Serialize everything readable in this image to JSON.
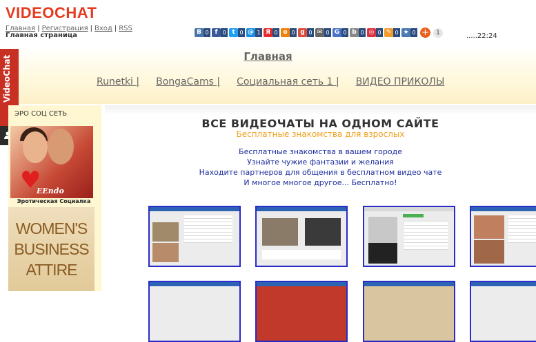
{
  "site": {
    "logo": "VIDEOCHAT",
    "links": [
      "Главная",
      "Регистрация",
      "Вход",
      "RSS"
    ],
    "link_sep": "|",
    "subtitle": "Главная страница",
    "clock": ".....22:24"
  },
  "share": {
    "buttons": [
      {
        "icon": "vkontakte-icon",
        "glyph": "В",
        "color": "#4a76a8",
        "count": "0"
      },
      {
        "icon": "facebook-icon",
        "glyph": "f",
        "color": "#3b5998",
        "count": "0"
      },
      {
        "icon": "twitter-icon",
        "glyph": "t",
        "color": "#1da1f2",
        "count": "0"
      },
      {
        "icon": "mailru-icon",
        "glyph": "@",
        "color": "#168de2",
        "count": "1"
      },
      {
        "icon": "yandex-icon",
        "glyph": "Я",
        "color": "#e52b2b",
        "count": "0"
      },
      {
        "icon": "odnoklassniki-icon",
        "glyph": "o",
        "color": "#ee8208",
        "count": "0"
      },
      {
        "icon": "googleplus-icon",
        "glyph": "g",
        "color": "#dd4b39",
        "count": "0"
      },
      {
        "icon": "email-icon",
        "glyph": "✉",
        "color": "#666666",
        "count": "0"
      },
      {
        "icon": "google-icon",
        "glyph": "G",
        "color": "#4a73c9",
        "count": "0"
      },
      {
        "icon": "blogger-icon",
        "glyph": "b",
        "color": "#888888",
        "count": "0"
      },
      {
        "icon": "liveinternet-icon",
        "glyph": "◎",
        "color": "#d9333f",
        "count": "0"
      },
      {
        "icon": "livejournal-icon",
        "glyph": "✎",
        "color": "#f39c2b",
        "count": "0"
      },
      {
        "icon": "bookmark-icon",
        "glyph": "★",
        "color": "#4c79b5",
        "count": "0"
      }
    ],
    "more_glyph": "+",
    "total": "1"
  },
  "hero": {
    "title": "Главная",
    "nav": [
      "Runetki |",
      "BongaCams |",
      "Социальная сеть 1 |",
      "ВИДЕО ПРИКОЛЫ"
    ]
  },
  "side_tab": {
    "label": "VideoChat"
  },
  "left": {
    "header": "ЭРО СОЦ СЕТЬ",
    "ad_brand": "EEndo",
    "ad_caption": "Эротическая Социалка",
    "ad2_text": "WOMEN'S BUSINESS ATTIRE"
  },
  "main": {
    "title": "ВСЕ ВИДЕОЧАТЫ НА ОДНОМ САЙТЕ",
    "subtitle": "Бесплатные  знакомства для взрослых",
    "lines": [
      "Бесплатные  знакомства в вашем городе",
      "Узнайте чужие  фантазии и желания",
      "Находите партнеров для общения в бесплатном видео чате",
      "И многое многое другое... Бесплатно!"
    ]
  },
  "colors": {
    "logo": "#e53a1e",
    "tab": "#c83023",
    "thumb_border": "#2a2ac8",
    "link_blue": "#1a2b9c",
    "subtitle_orange": "#f0a020"
  }
}
